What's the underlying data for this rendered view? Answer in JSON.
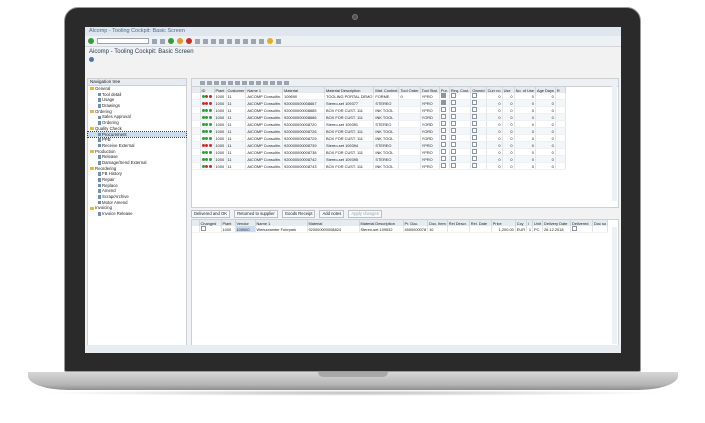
{
  "window": {
    "title": "Alcomp - Tooling Cockpit: Basic Screen"
  },
  "app": {
    "title": "Aicomp - Tooling Cockpit: Basic Screen"
  },
  "tree": {
    "header": "Navigation tree",
    "nodes": [
      {
        "label": "General",
        "level": 0,
        "folder": true
      },
      {
        "label": "Tool detail",
        "level": 1
      },
      {
        "label": "Usage",
        "level": 1
      },
      {
        "label": "Drawings",
        "level": 1
      },
      {
        "label": "Ordering",
        "level": 0,
        "folder": true
      },
      {
        "label": "Sales Approval",
        "level": 1
      },
      {
        "label": "Ordering",
        "level": 1
      },
      {
        "label": "Quality Check",
        "level": 0,
        "folder": true
      },
      {
        "label": "Procurement",
        "level": 1,
        "selected": true
      },
      {
        "label": "PPB",
        "level": 1
      },
      {
        "label": "Receive External",
        "level": 1
      },
      {
        "label": "Production",
        "level": 0,
        "folder": true
      },
      {
        "label": "Release",
        "level": 1
      },
      {
        "label": "Damage/Send External",
        "level": 1
      },
      {
        "label": "Reordering",
        "level": 0,
        "folder": true
      },
      {
        "label": "FB History",
        "level": 1
      },
      {
        "label": "Repair",
        "level": 1
      },
      {
        "label": "Replace",
        "level": 1
      },
      {
        "label": "Amend",
        "level": 1
      },
      {
        "label": "Scrap/Archive",
        "level": 1
      },
      {
        "label": "Motor Amend",
        "level": 1
      },
      {
        "label": "Invoicing",
        "level": 0,
        "folder": true
      },
      {
        "label": "Invoice Release",
        "level": 1
      }
    ]
  },
  "grid1": {
    "columns": [
      "ID",
      "Plant",
      "Customer",
      "Name 1",
      "Material",
      "Material Description",
      "Mat. Context",
      "Tool Order",
      "Tool Stat.",
      "Pur.",
      "Req. Cust.",
      "Owned",
      "Curr no",
      "Use",
      "No. of Use",
      "Age Days",
      "R"
    ],
    "rows": [
      {
        "lights": [
          "green",
          "red",
          "red"
        ],
        "plant": "1000",
        "cust": "11",
        "name": "AICOMP Consultin.",
        "mat": "109690",
        "desc": "TOOLING PORTAL DEMO",
        "ctx": "FORME",
        "order": "0",
        "stat": "YPRO",
        "pur": true,
        "req": false,
        "own": false,
        "cur": "0",
        "use": "0",
        "nou": "0",
        "age": "0"
      },
      {
        "lights": [
          "red",
          "red",
          "red"
        ],
        "plant": "1000",
        "cust": "11",
        "name": "AICOMP Consultin.",
        "mat": "920000000008667",
        "desc": "Stereo-set 109377",
        "ctx": "STEREO",
        "order": "",
        "stat": "YPRO",
        "pur": true,
        "req": false,
        "own": false,
        "cur": "0",
        "use": "0",
        "nou": "0",
        "age": "0"
      },
      {
        "lights": [
          "green",
          "green",
          "green"
        ],
        "plant": "1000",
        "cust": "11",
        "name": "AICOMP Consultin.",
        "mat": "920000000008685",
        "desc": "BOX FOR CUST. 111",
        "ctx": "INK TOOL",
        "order": "",
        "stat": "YPRO",
        "pur": false,
        "req": false,
        "own": false,
        "cur": "0",
        "use": "0",
        "nou": "0",
        "age": "0"
      },
      {
        "lights": [
          "green",
          "green",
          "green"
        ],
        "plant": "1000",
        "cust": "11",
        "name": "AICOMP Consultin.",
        "mat": "920000000008686",
        "desc": "BOX FOR CUST. 111",
        "ctx": "INK TOOL",
        "order": "",
        "stat": "YORD",
        "pur": false,
        "req": false,
        "own": false,
        "cur": "0",
        "use": "0",
        "nou": "0",
        "age": "0"
      },
      {
        "lights": [
          "green",
          "green",
          "green"
        ],
        "plant": "1000",
        "cust": "11",
        "name": "AICOMP Consultin.",
        "mat": "920000000008720",
        "desc": "Stereo-set 109391",
        "ctx": "STEREO",
        "order": "",
        "stat": "YORD",
        "pur": false,
        "req": false,
        "own": false,
        "cur": "0",
        "use": "0",
        "nou": "0",
        "age": "0"
      },
      {
        "lights": [
          "green",
          "green",
          "green"
        ],
        "plant": "1000",
        "cust": "11",
        "name": "AICOMP Consultin.",
        "mat": "920000000008726",
        "desc": "BOX FOR CUST. 111",
        "ctx": "INK TOOL",
        "order": "",
        "stat": "YORD",
        "pur": false,
        "req": false,
        "own": false,
        "cur": "0",
        "use": "0",
        "nou": "0",
        "age": "0"
      },
      {
        "lights": [
          "green",
          "green",
          "green"
        ],
        "plant": "1000",
        "cust": "11",
        "name": "AICOMP Consultin.",
        "mat": "920000000008729",
        "desc": "BOX FOR CUST. 111",
        "ctx": "INK TOOL",
        "order": "",
        "stat": "YORD",
        "pur": false,
        "req": false,
        "own": false,
        "cur": "0",
        "use": "0",
        "nou": "0",
        "age": "0"
      },
      {
        "lights": [
          "red",
          "red",
          "red"
        ],
        "plant": "1000",
        "cust": "11",
        "name": "AICOMP Consultin.",
        "mat": "920000000008739",
        "desc": "Stereo-set 109394",
        "ctx": "STEREO",
        "order": "",
        "stat": "YPRO",
        "pur": false,
        "req": false,
        "own": false,
        "cur": "0",
        "use": "0",
        "nou": "0",
        "age": "0"
      },
      {
        "lights": [
          "green",
          "green",
          "green"
        ],
        "plant": "1000",
        "cust": "11",
        "name": "AICOMP Consultin.",
        "mat": "920000000008738",
        "desc": "BOX FOR CUST. 111",
        "ctx": "INK TOOL",
        "order": "",
        "stat": "YPRO",
        "pur": false,
        "req": false,
        "own": false,
        "cur": "0",
        "use": "0",
        "nou": "0",
        "age": "0"
      },
      {
        "lights": [
          "green",
          "green",
          "green"
        ],
        "plant": "1000",
        "cust": "11",
        "name": "AICOMP Consultin.",
        "mat": "920000000008742",
        "desc": "Stereo-set 109395",
        "ctx": "STEREO",
        "order": "",
        "stat": "YPRO",
        "pur": false,
        "req": false,
        "own": false,
        "cur": "0",
        "use": "0",
        "nou": "0",
        "age": "0"
      },
      {
        "lights": [
          "green",
          "red",
          "red"
        ],
        "plant": "1000",
        "cust": "11",
        "name": "AICOMP Consultin.",
        "mat": "920000000008743",
        "desc": "BOX FOR CUST. 111",
        "ctx": "INK TOOL",
        "order": "",
        "stat": "YPRO",
        "pur": false,
        "req": false,
        "own": false,
        "cur": "0",
        "use": "0",
        "nou": "0",
        "age": "0"
      }
    ]
  },
  "actions": {
    "delivered": "Delivered and OK",
    "returned": "Returned to supplier",
    "goods": "Goods Receipt",
    "notes": "Add notes",
    "apply": "Apply changes"
  },
  "grid2": {
    "columns": [
      "Changed",
      "Plant",
      "Vendor",
      "Name 1",
      "Material",
      "Material Description",
      "Pr. Doc.",
      "Doc. Item",
      "Rel Descr.",
      "Rel. Date",
      "Price",
      "Ccy",
      "/",
      "Unit",
      "Delivery Date",
      "Delivered",
      "Doc so"
    ],
    "row": {
      "plant": "1000",
      "vendor": "100000",
      "name": "Werkzeamter Fuhrpark",
      "mat": "920000000008824",
      "desc": "Stereo-set 109532",
      "prdoc": "4500000078",
      "item": "10",
      "price": "1,200.00",
      "ccy": "EUR",
      "per": "1",
      "unit": "PC",
      "date": "26.12.2018"
    }
  },
  "colors": {
    "green": "#2e9e3a",
    "red": "#d12a2a",
    "selected": "#c9ddf2"
  }
}
